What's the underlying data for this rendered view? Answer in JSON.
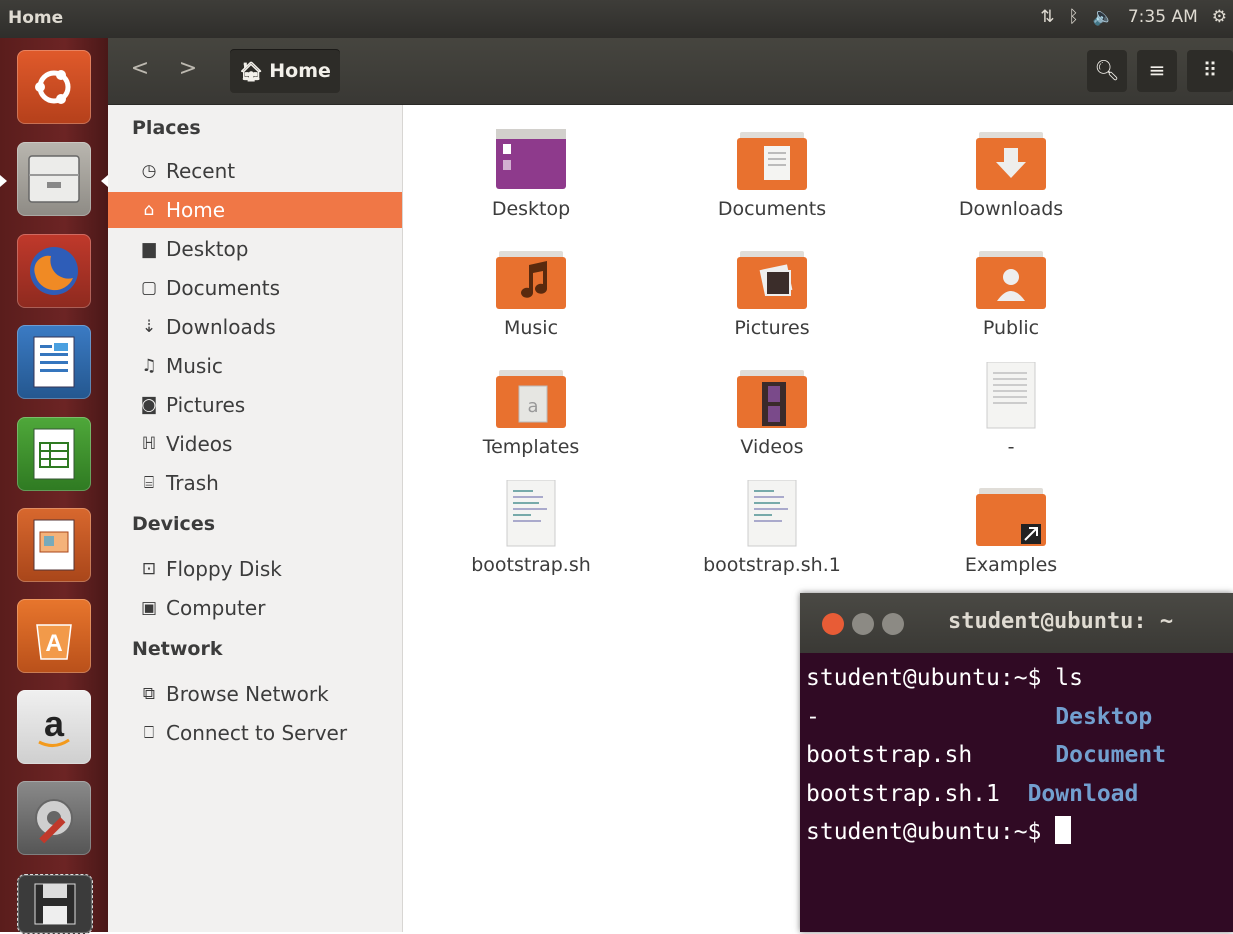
{
  "top_panel": {
    "window_title": "Home",
    "time": "7:35 AM"
  },
  "launcher": {
    "items": [
      "ubuntu-dash",
      "files",
      "firefox",
      "libreoffice-writer",
      "libreoffice-calc",
      "libreoffice-impress",
      "ubuntu-software-center",
      "amazon",
      "system-settings",
      "floppy-disk"
    ]
  },
  "header": {
    "back_glyph": "<",
    "forward_glyph": ">",
    "path_label": "Home"
  },
  "sidebar": {
    "places_heading": "Places",
    "places": [
      {
        "label": "Recent",
        "icon": "clock-icon"
      },
      {
        "label": "Home",
        "icon": "home-icon"
      },
      {
        "label": "Desktop",
        "icon": "folder-icon"
      },
      {
        "label": "Documents",
        "icon": "document-icon"
      },
      {
        "label": "Downloads",
        "icon": "download-icon"
      },
      {
        "label": "Music",
        "icon": "music-icon"
      },
      {
        "label": "Pictures",
        "icon": "camera-icon"
      },
      {
        "label": "Videos",
        "icon": "film-icon"
      },
      {
        "label": "Trash",
        "icon": "trash-icon"
      }
    ],
    "devices_heading": "Devices",
    "devices": [
      {
        "label": "Floppy Disk",
        "icon": "floppy-icon"
      },
      {
        "label": "Computer",
        "icon": "computer-icon"
      }
    ],
    "network_heading": "Network",
    "network": [
      {
        "label": "Browse Network",
        "icon": "network-icon"
      },
      {
        "label": "Connect to Server",
        "icon": "server-icon"
      }
    ]
  },
  "files": [
    {
      "name": "Desktop"
    },
    {
      "name": "Documents"
    },
    {
      "name": "Downloads"
    },
    {
      "name": "Music"
    },
    {
      "name": "Pictures"
    },
    {
      "name": "Public"
    },
    {
      "name": "Templates"
    },
    {
      "name": "Videos"
    },
    {
      "name": "-"
    },
    {
      "name": "bootstrap.sh"
    },
    {
      "name": "bootstrap.sh.1"
    },
    {
      "name": "Examples"
    }
  ],
  "terminal": {
    "title": "student@ubuntu: ~",
    "lines": {
      "l1_prompt": "student@ubuntu:~$ ls",
      "l2_file": "-",
      "l2_dir": "Desktop",
      "l3_file": "bootstrap.sh",
      "l3_dir": "Document",
      "l4_file": "bootstrap.sh.1",
      "l4_dir": "Download",
      "l5_prompt": "student@ubuntu:~$ "
    }
  },
  "colors": {
    "accent": "#f07746",
    "terminal_bg": "#300a24",
    "launcher_bg": "#6c2424"
  }
}
